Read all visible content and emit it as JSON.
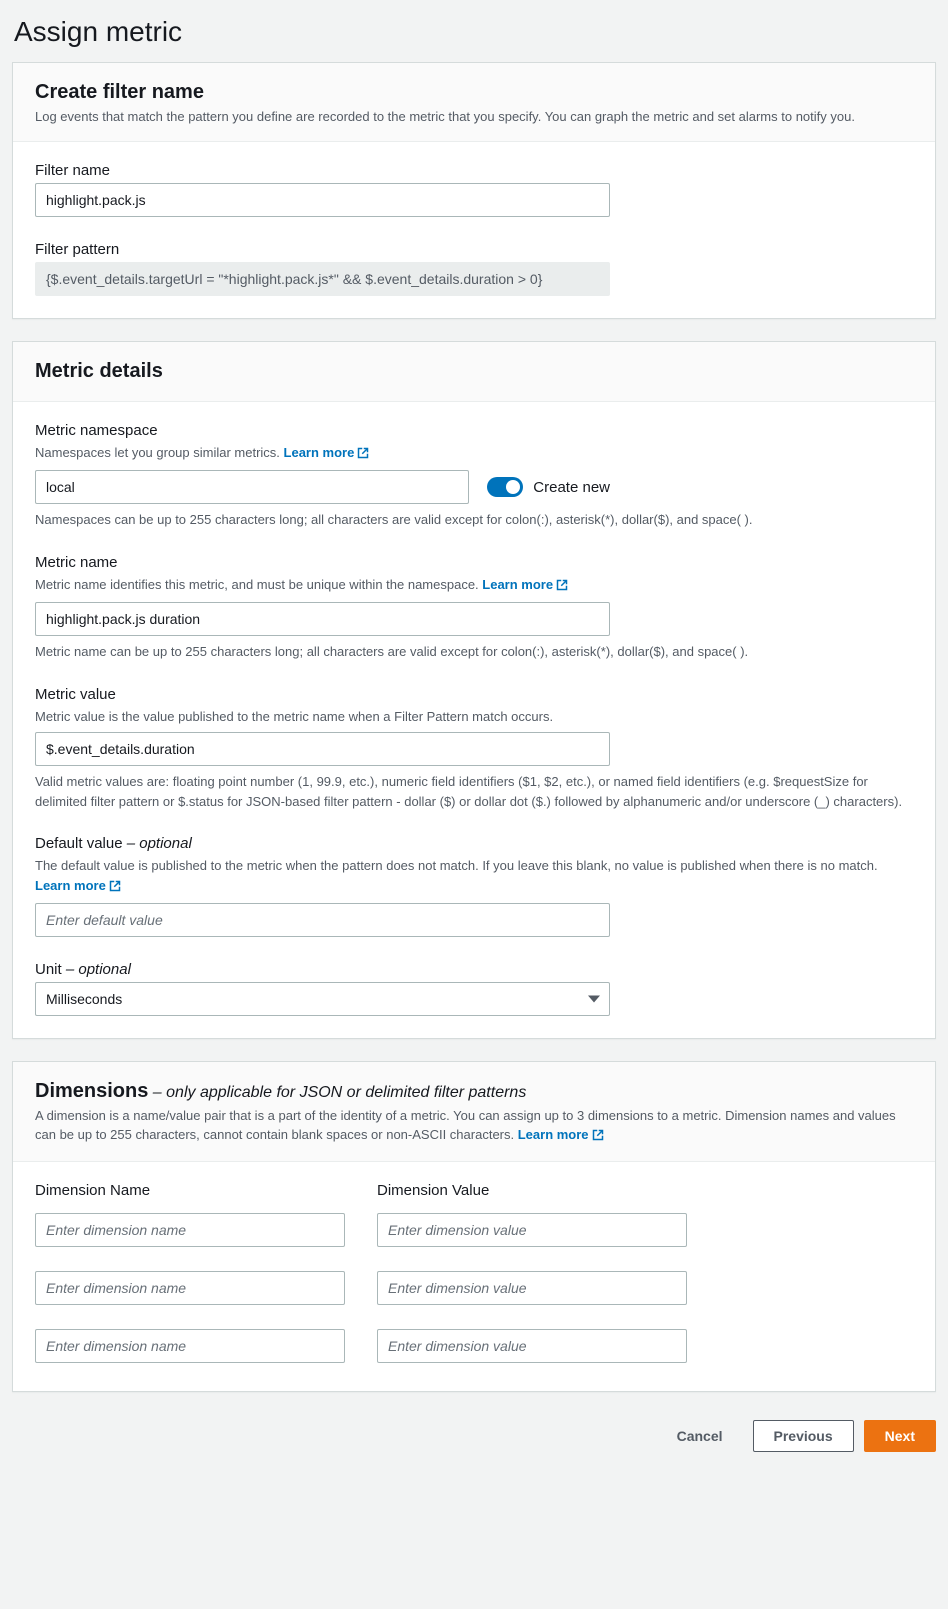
{
  "page_title": "Assign metric",
  "create_filter": {
    "title": "Create filter name",
    "desc": "Log events that match the pattern you define are recorded to the metric that you specify. You can graph the metric and set alarms to notify you.",
    "filter_name_label": "Filter name",
    "filter_name_value": "highlight.pack.js",
    "filter_pattern_label": "Filter pattern",
    "filter_pattern_value": "{$.event_details.targetUrl = \"*highlight.pack.js*\" && $.event_details.duration > 0}"
  },
  "metric_details": {
    "title": "Metric details",
    "namespace": {
      "label": "Metric namespace",
      "help": "Namespaces let you group similar metrics. ",
      "learn_more": "Learn more",
      "value": "local",
      "toggle_label": "Create new",
      "constraint": "Namespaces can be up to 255 characters long; all characters are valid except for colon(:), asterisk(*), dollar($), and space( )."
    },
    "name": {
      "label": "Metric name",
      "help": "Metric name identifies this metric, and must be unique within the namespace. ",
      "learn_more": "Learn more",
      "value": "highlight.pack.js duration",
      "constraint": "Metric name can be up to 255 characters long; all characters are valid except for colon(:), asterisk(*), dollar($), and space( )."
    },
    "value": {
      "label": "Metric value",
      "help": "Metric value is the value published to the metric name when a Filter Pattern match occurs.",
      "value": "$.event_details.duration",
      "constraint": "Valid metric values are: floating point number (1, 99.9, etc.), numeric field identifiers ($1, $2, etc.), or named field identifiers (e.g. $requestSize for delimited filter pattern or $.status for JSON-based filter pattern - dollar ($) or dollar dot ($.) followed by alphanumeric and/or underscore (_) characters)."
    },
    "default": {
      "label": "Default value",
      "optional": " – optional",
      "help_prefix": "The default value is published to the metric when the pattern does not match. If you leave this blank, no value is published when there is no match. ",
      "learn_more": "Learn more",
      "placeholder": "Enter default value"
    },
    "unit": {
      "label": "Unit",
      "optional": " – optional",
      "value": "Milliseconds"
    }
  },
  "dimensions": {
    "title": "Dimensions",
    "title_note": " – only applicable for JSON or delimited filter patterns",
    "desc_prefix": "A dimension is a name/value pair that is a part of the identity of a metric. You can assign up to 3 dimensions to a metric. Dimension names and values can be up to 255 characters, cannot contain blank spaces or non-ASCII characters. ",
    "learn_more": "Learn more",
    "name_col": "Dimension Name",
    "value_col": "Dimension Value",
    "name_placeholder": "Enter dimension name",
    "value_placeholder": "Enter dimension value"
  },
  "footer": {
    "cancel": "Cancel",
    "previous": "Previous",
    "next": "Next"
  }
}
